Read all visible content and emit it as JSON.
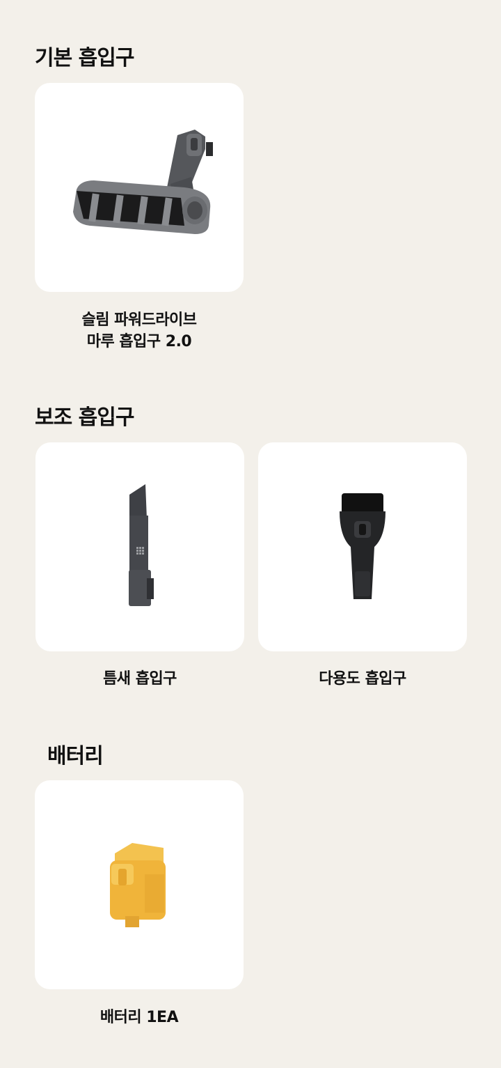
{
  "sections": [
    {
      "title": "기본 흡입구",
      "items": [
        {
          "caption_lines": [
            "슬림 파워드라이브",
            "마루 흡입구 2.0"
          ],
          "icon": "power-drive-floor-nozzle"
        }
      ]
    },
    {
      "title": "보조 흡입구",
      "items": [
        {
          "caption_lines": [
            "틈새 흡입구"
          ],
          "icon": "crevice-nozzle"
        },
        {
          "caption_lines": [
            "다용도 흡입구"
          ],
          "icon": "multi-purpose-brush-nozzle"
        }
      ]
    },
    {
      "title": "배터리",
      "items": [
        {
          "caption_lines": [
            "배터리 1EA"
          ],
          "icon": "battery-pack"
        }
      ]
    }
  ],
  "colors": {
    "background": "#f3f0ea",
    "card": "#ffffff",
    "text": "#111111",
    "product_gray": "#5a5c60",
    "battery_yellow": "#f0b43a"
  }
}
